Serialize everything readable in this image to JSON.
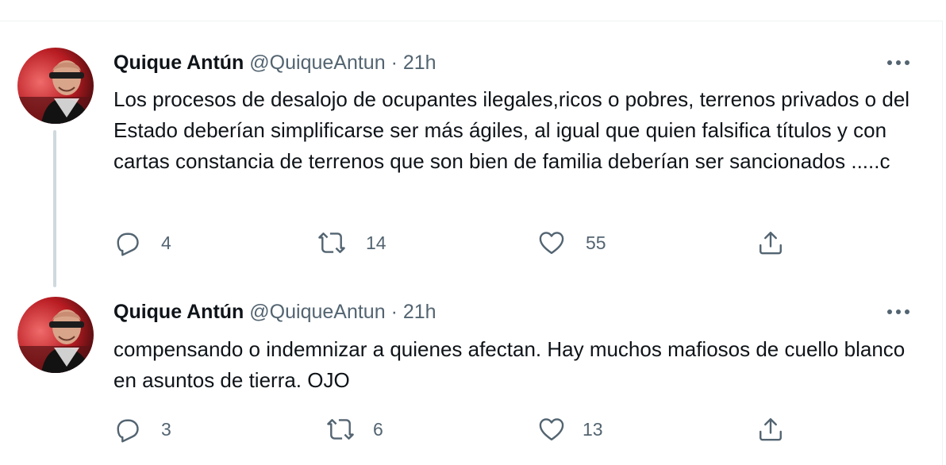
{
  "tweets": [
    {
      "author_name": "Quique Antún",
      "handle": "@QuiqueAntun",
      "separator": "·",
      "time": "21h",
      "text": "Los procesos de desalojo de ocupantes ilegales,ricos o pobres, terrenos privados o del Estado deberían simplificarse ser más ágiles, al igual que quien falsifica títulos y con cartas constancia de terrenos que son bien de familia deberían ser sancionados .....c",
      "replies": "4",
      "retweets": "14",
      "likes": "55"
    },
    {
      "author_name": "Quique Antún",
      "handle": "@QuiqueAntun",
      "separator": "·",
      "time": "21h",
      "text": "compensando o indemnizar a quienes afectan. Hay muchos mafiosos de cuello blanco en asuntos de tierra. OJO",
      "replies": "3",
      "retweets": "6",
      "likes": "13"
    }
  ],
  "icons": {
    "reply": "reply-icon",
    "retweet": "retweet-icon",
    "like": "like-icon",
    "share": "share-icon",
    "more": "more-icon"
  },
  "colors": {
    "text": "#0f1419",
    "muted": "#536471",
    "divider": "#eff3f4",
    "thread_line": "#cfd9de"
  }
}
